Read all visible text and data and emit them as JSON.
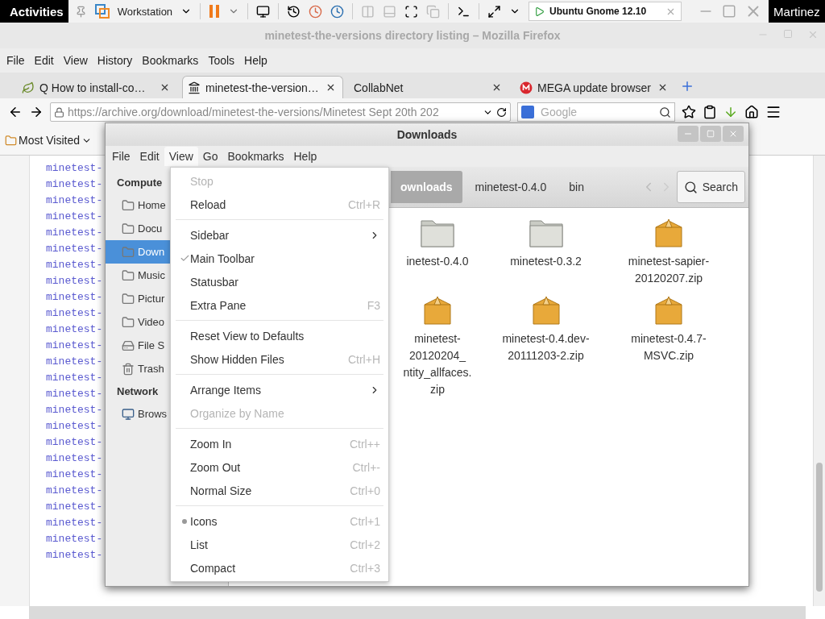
{
  "vm_bar": {
    "activities": "Activities",
    "menu_label": "Workstation",
    "vm_tab": "Ubuntu Gnome 12.10",
    "user": "Martinez"
  },
  "firefox": {
    "title": "minetest-the-versions directory listing – Mozilla Firefox",
    "menu": [
      "File",
      "Edit",
      "View",
      "History",
      "Bookmarks",
      "Tools",
      "Help"
    ],
    "tabs": [
      {
        "label": "Q How to install-co…",
        "selected": false
      },
      {
        "label": "minetest-the-version…",
        "selected": true
      },
      {
        "label": "CollabNet",
        "selected": false
      },
      {
        "label": "MEGA update browser",
        "selected": false
      }
    ],
    "url": "https://archive.org/download/minetest-the-versions/Minetest Sept 20th 202",
    "search": {
      "placeholder": "Google"
    },
    "bookmarks": [
      "Most Visited"
    ],
    "links": [
      "minetest-",
      "minetest-",
      "minetest-",
      "minetest-",
      "minetest-",
      "minetest-",
      "minetest-",
      "minetest-",
      "minetest-",
      "minetest-",
      "minetest-",
      "minetest-",
      "minetest-",
      "minetest-",
      "minetest-",
      "minetest-",
      "minetest-",
      "minetest-",
      "minetest-",
      "minetest-",
      "minetest-",
      "minetest-",
      "minetest-",
      "minetest-",
      "minetest-"
    ]
  },
  "downloads": {
    "title": "Downloads",
    "menu": [
      {
        "label": "File",
        "selected": false
      },
      {
        "label": "Edit",
        "selected": false
      },
      {
        "label": "View",
        "selected": true
      },
      {
        "label": "Go",
        "selected": false
      },
      {
        "label": "Bookmarks",
        "selected": false
      },
      {
        "label": "Help",
        "selected": false
      }
    ],
    "sidebar": [
      {
        "heading": "Compute",
        "items": [
          {
            "label": "Home",
            "selected": false
          },
          {
            "label": "Docu",
            "selected": false
          },
          {
            "label": "Down",
            "selected": true
          },
          {
            "label": "Music",
            "selected": false
          },
          {
            "label": "Pictur",
            "selected": false
          },
          {
            "label": "Video",
            "selected": false
          },
          {
            "label": "File S",
            "selected": false
          },
          {
            "label": "Trash",
            "selected": false
          }
        ]
      },
      {
        "heading": "Network",
        "items": [
          {
            "label": "Brows",
            "selected": false
          }
        ]
      }
    ],
    "path": [
      {
        "label": "ownloads",
        "selected": true
      },
      {
        "label": "minetest-0.4.0",
        "selected": false
      },
      {
        "label": "bin",
        "selected": false
      }
    ],
    "search_button": "Search",
    "files": [
      {
        "kind": "folder",
        "lines": [
          "inetest-0.4.0"
        ]
      },
      {
        "kind": "folder",
        "lines": [
          "minetest-0.3.2"
        ]
      },
      {
        "kind": "archive",
        "lines": [
          "minetest-sapier-",
          "20120207.zip"
        ]
      },
      {
        "kind": "archive",
        "lines": [
          "minetest-",
          "20120204_",
          "ntity_allfaces.",
          "zip"
        ]
      },
      {
        "kind": "archive",
        "lines": [
          "minetest-0.4.dev-",
          "20111203-2.zip"
        ]
      },
      {
        "kind": "archive",
        "lines": [
          "minetest-0.4.7-",
          "MSVC.zip"
        ]
      }
    ],
    "view_menu": [
      [
        {
          "kind": "item",
          "label": "Stop",
          "disabled": true
        },
        {
          "kind": "item",
          "label": "Reload",
          "shortcut": "Ctrl+R",
          "disabled": false
        }
      ],
      [
        {
          "kind": "submenu",
          "label": "Sidebar",
          "disabled": false
        },
        {
          "kind": "check",
          "label": "Main Toolbar",
          "checked": true,
          "disabled": false
        },
        {
          "kind": "check",
          "label": "Statusbar",
          "checked": false,
          "disabled": false
        },
        {
          "kind": "check",
          "label": "Extra Pane",
          "checked": false,
          "shortcut": "F3",
          "disabled": false
        }
      ],
      [
        {
          "kind": "item",
          "label": "Reset View to Defaults",
          "disabled": false
        },
        {
          "kind": "check",
          "label": "Show Hidden Files",
          "checked": false,
          "shortcut": "Ctrl+H",
          "disabled": false
        }
      ],
      [
        {
          "kind": "submenu",
          "label": "Arrange Items",
          "disabled": false
        },
        {
          "kind": "item",
          "label": "Organize by Name",
          "disabled": true
        }
      ],
      [
        {
          "kind": "item",
          "label": "Zoom In",
          "shortcut": "Ctrl++",
          "disabled": false
        },
        {
          "kind": "item",
          "label": "Zoom Out",
          "shortcut": "Ctrl+-",
          "disabled": false
        },
        {
          "kind": "item",
          "label": "Normal Size",
          "shortcut": "Ctrl+0",
          "disabled": false
        }
      ],
      [
        {
          "kind": "radio",
          "label": "Icons",
          "selected": true,
          "shortcut": "Ctrl+1",
          "disabled": false
        },
        {
          "kind": "radio",
          "label": "List",
          "selected": false,
          "shortcut": "Ctrl+2",
          "disabled": false
        },
        {
          "kind": "radio",
          "label": "Compact",
          "selected": false,
          "shortcut": "Ctrl+3",
          "disabled": false
        }
      ]
    ]
  }
}
